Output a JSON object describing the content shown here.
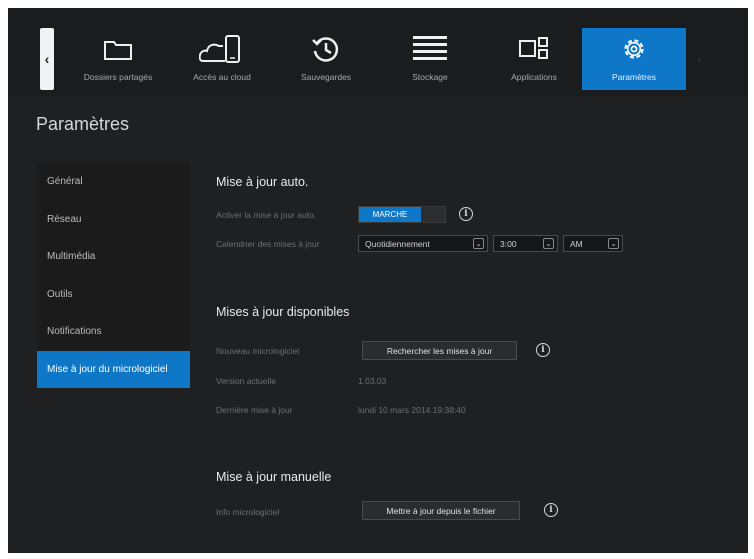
{
  "nav": {
    "back_glyph": "‹",
    "items": [
      {
        "label": "Dossiers partagés",
        "icon": "folder-icon"
      },
      {
        "label": "Accès au cloud",
        "icon": "cloud-device-icon"
      },
      {
        "label": "Sauvegardes",
        "icon": "history-icon"
      },
      {
        "label": "Stockage",
        "icon": "storage-stack-icon"
      },
      {
        "label": "Applications",
        "icon": "apps-grid-icon"
      },
      {
        "label": "Paramètres",
        "icon": "gear-icon",
        "active": true
      }
    ],
    "more_glyph": "›",
    "active_color": "#0f77c8"
  },
  "page": {
    "title": "Paramètres"
  },
  "sidebar": {
    "items": [
      {
        "label": "Général"
      },
      {
        "label": "Réseau"
      },
      {
        "label": "Multimédia"
      },
      {
        "label": "Outils"
      },
      {
        "label": "Notifications"
      },
      {
        "label": "Mise à jour du micrologiciel",
        "active": true
      }
    ]
  },
  "auto_update": {
    "title": "Mise à jour auto.",
    "enable_label": "Activer la mise à jour auto.",
    "toggle_on_label": "MARCHE",
    "schedule_label": "Calendrier des mises à jour",
    "frequency": "Quotidiennement",
    "time": "3:00",
    "ampm": "AM"
  },
  "available": {
    "title": "Mises à jour disponibles",
    "new_firmware_label": "Nouveau micrologiciel",
    "check_button": "Rechercher les mises à jour",
    "current_version_label": "Version actuelle",
    "current_version": "1.03.03",
    "last_update_label": "Dernière mise à jour",
    "last_update_value": "lundi 10 mars 2014 19:38:40"
  },
  "manual": {
    "title": "Mise à jour manuelle",
    "label": "Info micrologiciel",
    "button": "Mettre à jour depuis le fichier"
  },
  "info_glyph": "i",
  "chevron_glyph": "⌄"
}
